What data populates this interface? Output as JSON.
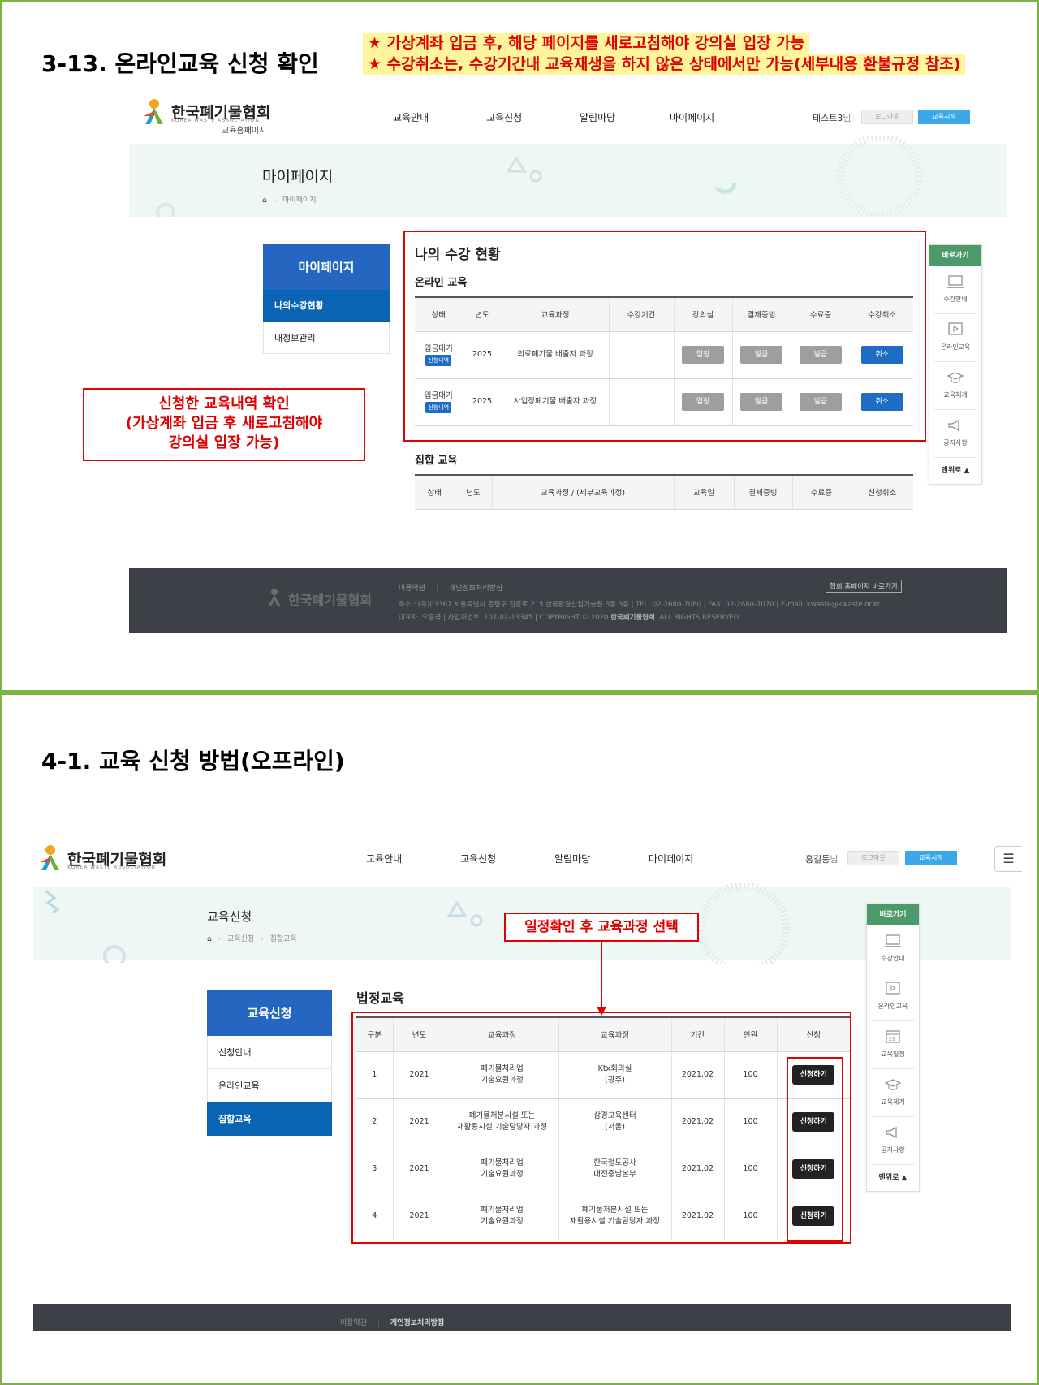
{
  "slide1": {
    "title": "3-13. 온라인교육 신청 확인",
    "notice1": "★ 가상계좌 입금 후, 해당 페이지를 새로고침해야 강의실 입장 가능",
    "notice2": "★ 수강취소는, 수강기간내 교육재생을 하지 않은 상태에서만 가능(세부내용 환불규정 참조)",
    "logo": {
      "name": "한국폐기물협회",
      "eng": "KOREA WASTE ASSOCIATION",
      "sub": "교육홈페이지"
    },
    "nav": [
      "교육안내",
      "교육신청",
      "알림마당",
      "마이페이지"
    ],
    "user": {
      "name": "테스트3",
      "suffix": "님",
      "logout": "로그아웃",
      "start": "교육시작"
    },
    "banner": {
      "title": "마이페이지",
      "crumb": "마이페이지"
    },
    "side": {
      "title": "마이페이지",
      "items": [
        "나의수강현황",
        "내정보관리"
      ]
    },
    "main_title": "나의 수강 현황",
    "online": {
      "title": "온라인 교육",
      "headers": [
        "상태",
        "년도",
        "교육과정",
        "수강기간",
        "강의실",
        "결제증빙",
        "수료증",
        "수강취소"
      ],
      "rows": [
        {
          "status": "입금대기",
          "tag": "신청내역",
          "year": "2025",
          "course": "의료폐기물 배출자 과정",
          "period": "",
          "room": "입장",
          "receipt": "발급",
          "cert": "발급",
          "cancel": "취소"
        },
        {
          "status": "입금대기",
          "tag": "신청내역",
          "year": "2025",
          "course": "사업장폐기물 배출자 과정",
          "period": "",
          "room": "입장",
          "receipt": "발급",
          "cert": "발급",
          "cancel": "취소"
        }
      ]
    },
    "group": {
      "title": "집합 교육",
      "headers": [
        "상태",
        "년도",
        "교육과정 / (세부교육과정)",
        "교육일",
        "결제증빙",
        "수료증",
        "신청취소"
      ]
    },
    "annotation": [
      "신청한 교육내역 확인",
      "(가상계좌 입금 후 새로고침해야",
      "강의실 입장 가능)"
    ],
    "quick": {
      "head": "바로가기",
      "items": [
        "수강안내",
        "온라인교육",
        "교육체계",
        "공지사항"
      ],
      "top": "맨위로 ▲"
    },
    "footer": {
      "links": [
        "이용약관",
        "개인정보처리방침"
      ],
      "addr1": "주소 : (우)03367 서울특별시 은평구 진흥로 215 한국환경산업기술원 B동 3층 | TEL. 02-2680-7080 | FAX. 02-2680-7070 | E-mail. kwaste@kwaste.or.kr",
      "addr2_pre": "대표자. 오흥국 | 사업자번호. 107-82-13345 | COPYRIGHT © 2020",
      "addr2_brand": "한국폐기물협회",
      "addr2_post": ". ALL RIGHTS RESERVED.",
      "home_btn": "협회 홈페이지 바로가기"
    }
  },
  "slide2": {
    "title": "4-1. 교육 신청 방법(오프라인)",
    "logo": {
      "name": "한국폐기물협회",
      "eng": "KOREA WASTE ASSOCIATION"
    },
    "nav": [
      "교육안내",
      "교육신청",
      "알림마당",
      "마이페이지"
    ],
    "user": {
      "name": "홍길동",
      "suffix": "님",
      "logout": "로그아웃",
      "start": "교육시작"
    },
    "banner": {
      "title": "교육신청",
      "crumb1": "교육신청",
      "crumb2": "집합교육"
    },
    "side": {
      "title": "교육신청",
      "items": [
        "신청안내",
        "온라인교육",
        "집합교육"
      ]
    },
    "section_title": "법정교육",
    "table": {
      "headers": [
        "구분",
        "년도",
        "교육과정",
        "교육과정",
        "기간",
        "인원",
        "신청"
      ],
      "rows": [
        {
          "no": "1",
          "year": "2021",
          "course1": "폐기물처리업",
          "course2": "기술요원과정",
          "place1": "Ktx회의실",
          "place2": "(광주)",
          "period": "2021.02",
          "count": "100",
          "apply": "신청하기"
        },
        {
          "no": "2",
          "year": "2021",
          "course1": "폐기물처분시설 또는",
          "course2": "재활용시설 기술담당자 과정",
          "place1": "삼경교육센터",
          "place2": "(서울)",
          "period": "2021.02",
          "count": "100",
          "apply": "신청하기"
        },
        {
          "no": "3",
          "year": "2021",
          "course1": "폐기물처리업",
          "course2": "기술요원과정",
          "place1": "한국철도공사",
          "place2": "대전충남본부",
          "period": "2021.02",
          "count": "100",
          "apply": "신청하기"
        },
        {
          "no": "4",
          "year": "2021",
          "course1": "폐기물처리업",
          "course2": "기술요원과정",
          "place1": "폐기물처분시설 또는",
          "place2": "재활용시설 기술담당자 과정",
          "period": "2021.02",
          "count": "100",
          "apply": "신청하기"
        }
      ]
    },
    "annotation": "일정확인 후 교육과정 선택",
    "quick": {
      "head": "바로가기",
      "items": [
        "수강안내",
        "온라인교육",
        "교육일정",
        "교육체계",
        "공지사항"
      ],
      "top": "맨위로 ▲"
    },
    "footer": {
      "links": [
        "이용약관",
        "개인정보처리방침"
      ]
    }
  },
  "colors": {
    "accent_blue": "#0a64b4",
    "annotation_red": "#e00000",
    "highlight_yellow": "#fff59d",
    "frame_green": "#7cb342",
    "quick_green": "#4c9a6a",
    "footer_dark": "#3d4046"
  }
}
